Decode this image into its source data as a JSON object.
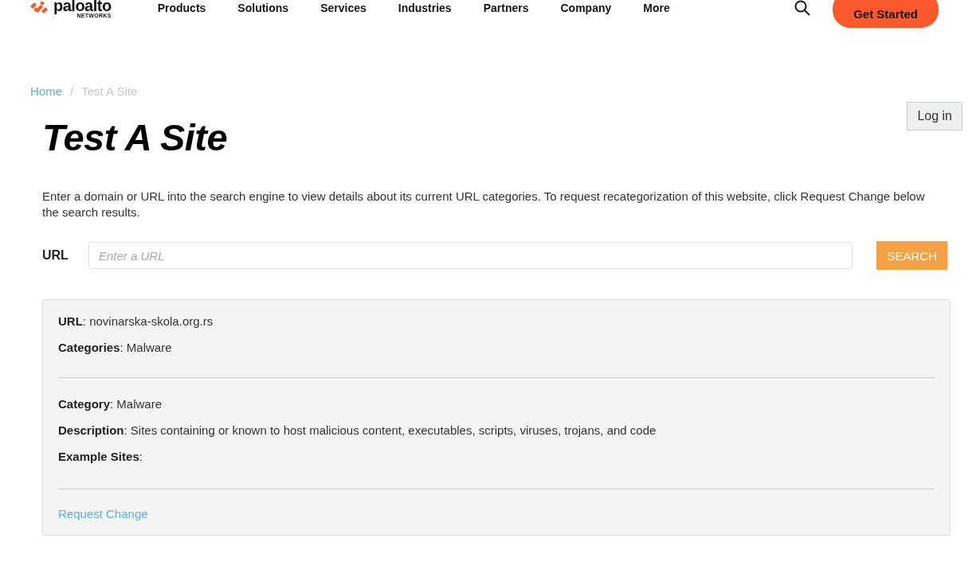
{
  "header": {
    "logo": {
      "name": "paloalto",
      "subtitle": "NETWORKS"
    },
    "nav": [
      "Products",
      "Solutions",
      "Services",
      "Industries",
      "Partners",
      "Company",
      "More"
    ],
    "cta": "Get Started"
  },
  "breadcrumb": {
    "separator": "/",
    "items": [
      {
        "label": "Home",
        "kind": "link"
      },
      {
        "label": "Test A Site",
        "kind": "current"
      }
    ]
  },
  "login": "Log in",
  "title": "Test A Site",
  "intro": "Enter a domain or URL into the search engine to view details about its current URL categories. To request recategorization of this website, click Request Change below the search results.",
  "search": {
    "label": "URL",
    "placeholder": "Enter a URL",
    "button": "SEARCH"
  },
  "result": {
    "summary": [
      "**URL**: novinarska-skola.org.rs",
      "**Categories**: Malware"
    ],
    "details": [
      "**Category**: Malware",
      "**Description**: Sites containing or known to host malicious content, executables, scripts, viruses, trojans, and code",
      "**Example Sites**:"
    ],
    "link": "Request Change"
  }
}
